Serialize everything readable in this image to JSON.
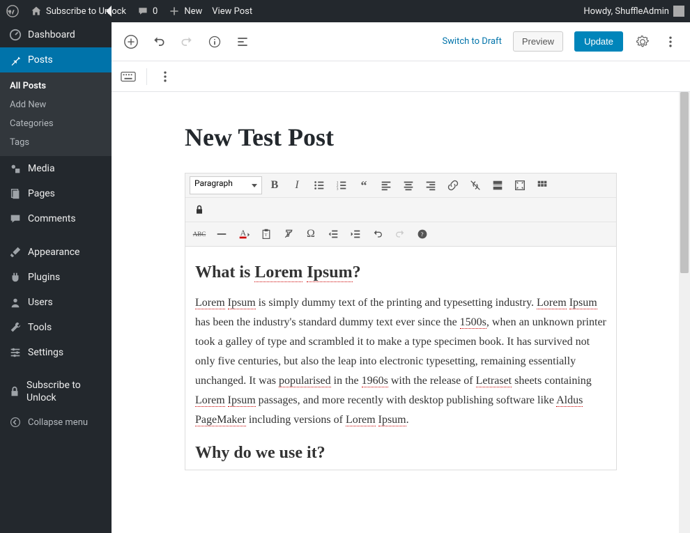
{
  "adminbar": {
    "site_title": "Subscribe to Unlock",
    "comments_count": "0",
    "new_label": "New",
    "view_post": "View Post",
    "howdy": "Howdy, ShuffleAdmin"
  },
  "sidebar": {
    "dashboard": "Dashboard",
    "posts": "Posts",
    "sub_all": "All Posts",
    "sub_add": "Add New",
    "sub_cat": "Categories",
    "sub_tags": "Tags",
    "media": "Media",
    "pages": "Pages",
    "comments": "Comments",
    "appearance": "Appearance",
    "plugins": "Plugins",
    "users": "Users",
    "tools": "Tools",
    "settings": "Settings",
    "subscribe": "Subscribe to Unlock",
    "collapse": "Collapse menu"
  },
  "topbar": {
    "switch_draft": "Switch to Draft",
    "preview": "Preview",
    "update": "Update"
  },
  "editor": {
    "title": "New Test Post",
    "format_select": "Paragraph",
    "abc_label": "ABC",
    "h2_prefix": "What is ",
    "h2_s1": "Lorem",
    "h2_s2": "Ipsum",
    "h2_suffix": "?",
    "p1a": "Lorem",
    "p1b": "Ipsum",
    "p1c": " is simply dummy text of the printing and typesetting industry. ",
    "p1d": "Lorem",
    "p1e": "Ipsum",
    "p1f": " has been the industry's standard dummy text ever since the ",
    "p1g": "1500s",
    "p1h": ", when an unknown printer took a galley of type and scrambled it to make a type specimen book. It has survived not only five centuries, but also the leap into electronic typesetting, remaining essentially unchanged. It was ",
    "p1i": "popularised",
    "p1j": " in the ",
    "p1k": "1960s",
    "p1l": " with the release of ",
    "p1m": "Letraset",
    "p1n": " sheets containing ",
    "p1o": "Lorem",
    "p1p": "Ipsum",
    "p1q": " passages, and more recently with desktop publishing software like ",
    "p1r": "Aldus",
    "p1s": "PageMaker",
    "p1t": " including versions of ",
    "p1u": "Lorem",
    "p1v": "Ipsum",
    "p1w": ".",
    "h2b": "Why do we use it?"
  }
}
